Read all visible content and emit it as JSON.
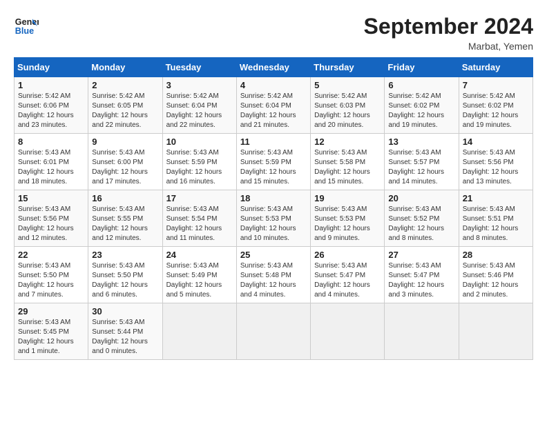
{
  "header": {
    "logo_line1": "General",
    "logo_line2": "Blue",
    "month_title": "September 2024",
    "location": "Marbat, Yemen"
  },
  "weekdays": [
    "Sunday",
    "Monday",
    "Tuesday",
    "Wednesday",
    "Thursday",
    "Friday",
    "Saturday"
  ],
  "weeks": [
    [
      {
        "day": "1",
        "sunrise": "5:42 AM",
        "sunset": "6:06 PM",
        "daylight": "12 hours and 23 minutes."
      },
      {
        "day": "2",
        "sunrise": "5:42 AM",
        "sunset": "6:05 PM",
        "daylight": "12 hours and 22 minutes."
      },
      {
        "day": "3",
        "sunrise": "5:42 AM",
        "sunset": "6:04 PM",
        "daylight": "12 hours and 22 minutes."
      },
      {
        "day": "4",
        "sunrise": "5:42 AM",
        "sunset": "6:04 PM",
        "daylight": "12 hours and 21 minutes."
      },
      {
        "day": "5",
        "sunrise": "5:42 AM",
        "sunset": "6:03 PM",
        "daylight": "12 hours and 20 minutes."
      },
      {
        "day": "6",
        "sunrise": "5:42 AM",
        "sunset": "6:02 PM",
        "daylight": "12 hours and 19 minutes."
      },
      {
        "day": "7",
        "sunrise": "5:42 AM",
        "sunset": "6:02 PM",
        "daylight": "12 hours and 19 minutes."
      }
    ],
    [
      {
        "day": "8",
        "sunrise": "5:43 AM",
        "sunset": "6:01 PM",
        "daylight": "12 hours and 18 minutes."
      },
      {
        "day": "9",
        "sunrise": "5:43 AM",
        "sunset": "6:00 PM",
        "daylight": "12 hours and 17 minutes."
      },
      {
        "day": "10",
        "sunrise": "5:43 AM",
        "sunset": "5:59 PM",
        "daylight": "12 hours and 16 minutes."
      },
      {
        "day": "11",
        "sunrise": "5:43 AM",
        "sunset": "5:59 PM",
        "daylight": "12 hours and 15 minutes."
      },
      {
        "day": "12",
        "sunrise": "5:43 AM",
        "sunset": "5:58 PM",
        "daylight": "12 hours and 15 minutes."
      },
      {
        "day": "13",
        "sunrise": "5:43 AM",
        "sunset": "5:57 PM",
        "daylight": "12 hours and 14 minutes."
      },
      {
        "day": "14",
        "sunrise": "5:43 AM",
        "sunset": "5:56 PM",
        "daylight": "12 hours and 13 minutes."
      }
    ],
    [
      {
        "day": "15",
        "sunrise": "5:43 AM",
        "sunset": "5:56 PM",
        "daylight": "12 hours and 12 minutes."
      },
      {
        "day": "16",
        "sunrise": "5:43 AM",
        "sunset": "5:55 PM",
        "daylight": "12 hours and 12 minutes."
      },
      {
        "day": "17",
        "sunrise": "5:43 AM",
        "sunset": "5:54 PM",
        "daylight": "12 hours and 11 minutes."
      },
      {
        "day": "18",
        "sunrise": "5:43 AM",
        "sunset": "5:53 PM",
        "daylight": "12 hours and 10 minutes."
      },
      {
        "day": "19",
        "sunrise": "5:43 AM",
        "sunset": "5:53 PM",
        "daylight": "12 hours and 9 minutes."
      },
      {
        "day": "20",
        "sunrise": "5:43 AM",
        "sunset": "5:52 PM",
        "daylight": "12 hours and 8 minutes."
      },
      {
        "day": "21",
        "sunrise": "5:43 AM",
        "sunset": "5:51 PM",
        "daylight": "12 hours and 8 minutes."
      }
    ],
    [
      {
        "day": "22",
        "sunrise": "5:43 AM",
        "sunset": "5:50 PM",
        "daylight": "12 hours and 7 minutes."
      },
      {
        "day": "23",
        "sunrise": "5:43 AM",
        "sunset": "5:50 PM",
        "daylight": "12 hours and 6 minutes."
      },
      {
        "day": "24",
        "sunrise": "5:43 AM",
        "sunset": "5:49 PM",
        "daylight": "12 hours and 5 minutes."
      },
      {
        "day": "25",
        "sunrise": "5:43 AM",
        "sunset": "5:48 PM",
        "daylight": "12 hours and 4 minutes."
      },
      {
        "day": "26",
        "sunrise": "5:43 AM",
        "sunset": "5:47 PM",
        "daylight": "12 hours and 4 minutes."
      },
      {
        "day": "27",
        "sunrise": "5:43 AM",
        "sunset": "5:47 PM",
        "daylight": "12 hours and 3 minutes."
      },
      {
        "day": "28",
        "sunrise": "5:43 AM",
        "sunset": "5:46 PM",
        "daylight": "12 hours and 2 minutes."
      }
    ],
    [
      {
        "day": "29",
        "sunrise": "5:43 AM",
        "sunset": "5:45 PM",
        "daylight": "12 hours and 1 minute."
      },
      {
        "day": "30",
        "sunrise": "5:43 AM",
        "sunset": "5:44 PM",
        "daylight": "12 hours and 0 minutes."
      },
      null,
      null,
      null,
      null,
      null
    ]
  ],
  "labels": {
    "sunrise": "Sunrise:",
    "sunset": "Sunset:",
    "daylight": "Daylight:"
  }
}
